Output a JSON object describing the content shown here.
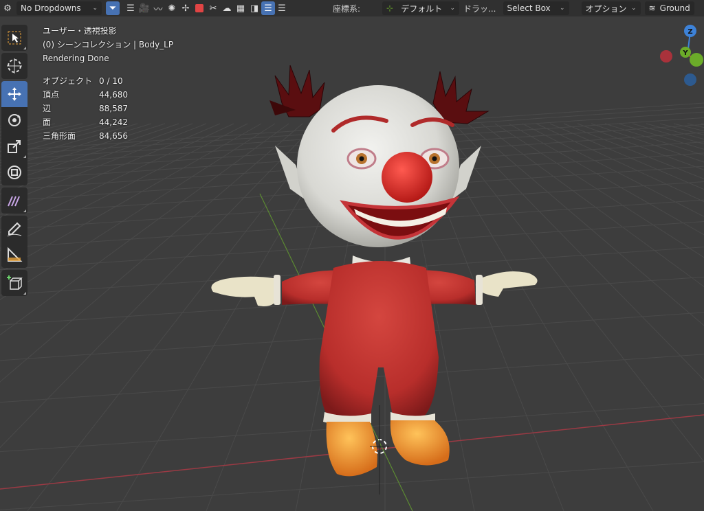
{
  "header": {
    "mode_dropdown": "No Dropdowns",
    "coord_label": "座標系:",
    "coord_value": "デフォルト",
    "drag_label": "ドラッ...",
    "select_box": "Select Box",
    "options": "オプション",
    "ground": "Ground",
    "icons": [
      "gear-icon",
      "funnel-icon",
      "list-icon",
      "camera-icon",
      "curves-icon",
      "particles-icon",
      "armature-icon",
      "red-square-icon",
      "wrench-icon",
      "brain-icon",
      "stripes-icon",
      "overlay-icon",
      "list-lines-icon"
    ]
  },
  "toolbar": {
    "tools": [
      "select-box-tool",
      "cursor-tool",
      "move-tool",
      "rotate-tool",
      "scale-tool",
      "transform-tool",
      "annotate-tool",
      "draw-tool",
      "measure-tool",
      "add-cube-tool"
    ],
    "active_tool": "move-tool",
    "accent": "#4772b3"
  },
  "viewport_info": {
    "view_name": "ユーザー・透視投影",
    "collection": "(0) シーンコレクション | Body_LP",
    "status": "Rendering Done"
  },
  "stats": [
    {
      "label": "オブジェクト",
      "value": "0 / 10"
    },
    {
      "label": "頂点",
      "value": "44,680"
    },
    {
      "label": "辺",
      "value": "88,587"
    },
    {
      "label": "面",
      "value": "44,242"
    },
    {
      "label": "三角形面",
      "value": "84,656"
    }
  ],
  "gizmo": {
    "z": "Z",
    "y": "Y",
    "colors": {
      "x": "#e0444e",
      "y": "#6bab29",
      "z": "#3d82d8"
    }
  }
}
